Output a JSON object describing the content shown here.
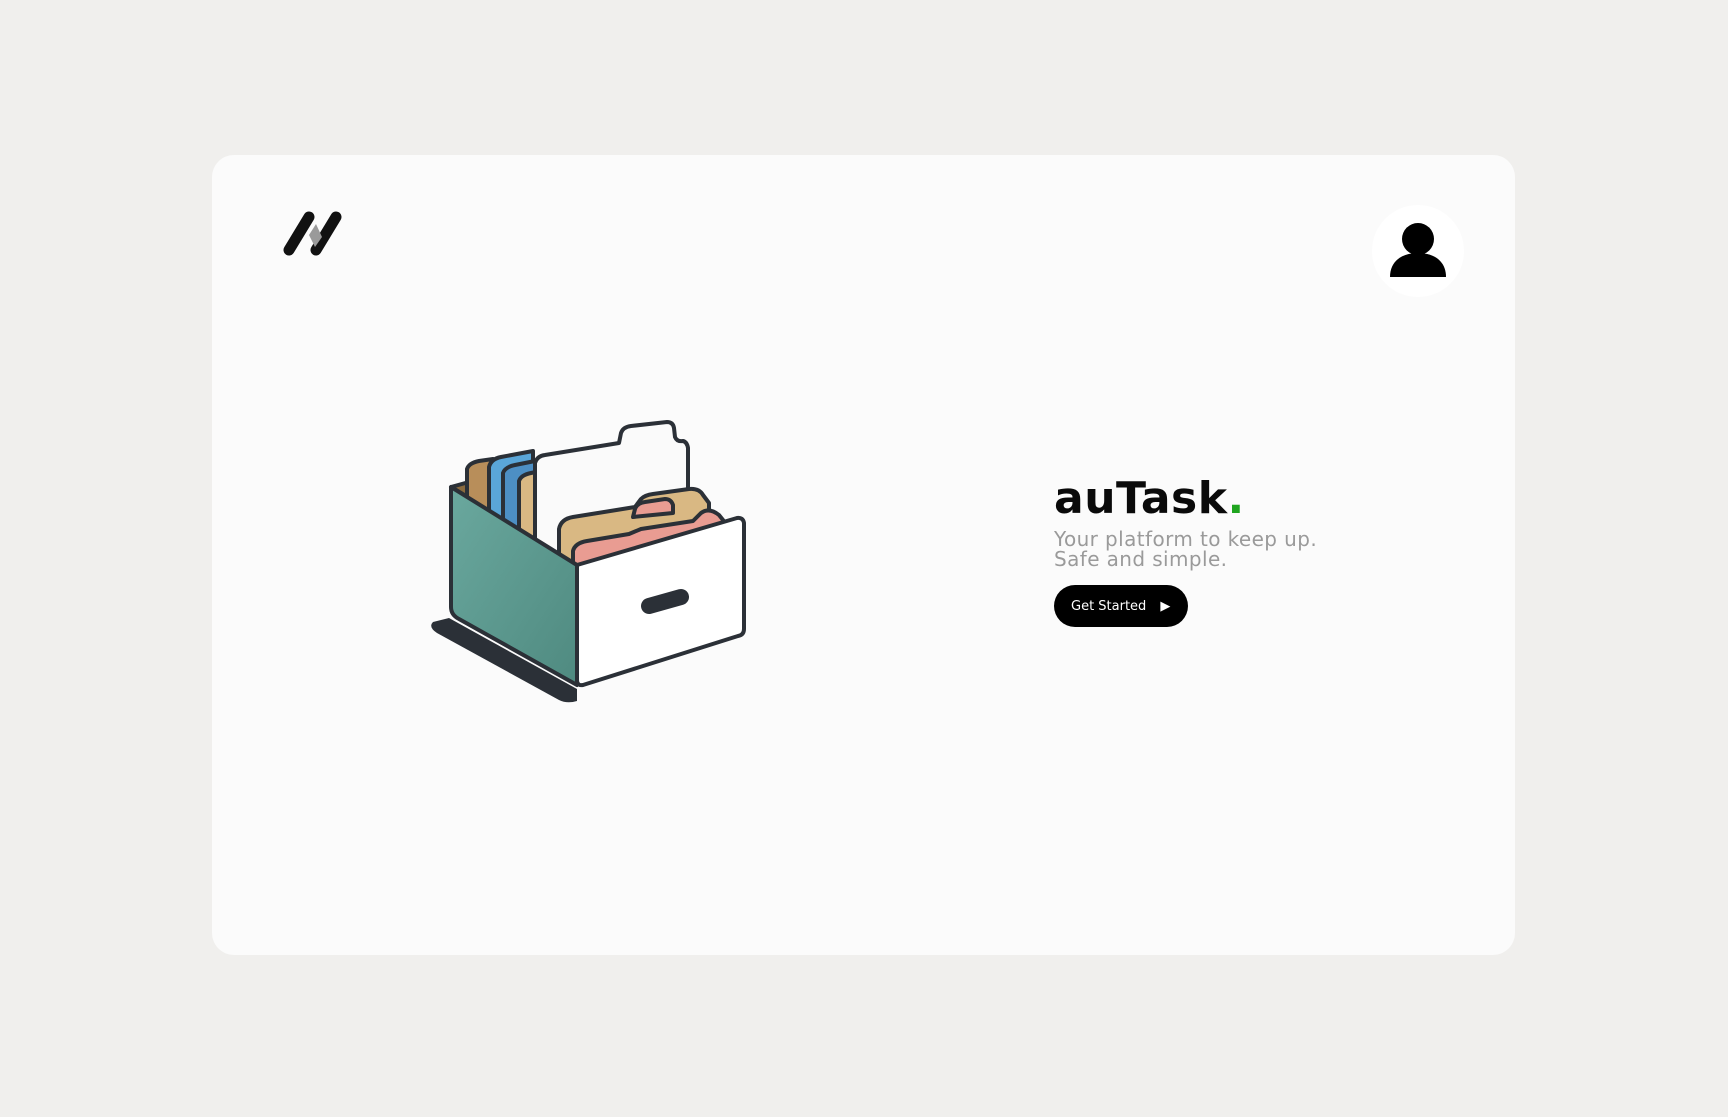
{
  "header": {
    "logo_icon": "brand-logo-icon",
    "avatar_icon": "user-avatar-icon"
  },
  "hero": {
    "title": "auTask",
    "title_dot": ".",
    "tagline_line1": "Your platform to keep up.",
    "tagline_line2": "Safe and simple.",
    "cta_label": "Get Started",
    "cta_icon": "play-icon"
  },
  "colors": {
    "page_background": "#f0efed",
    "card_background": "#fbfbfb",
    "accent_dot": "#1fa51f",
    "button_background": "#000000",
    "tagline": "#9a9a9a",
    "box_side": "#5e9c92"
  },
  "illustration": {
    "icon": "file-box-icon"
  }
}
